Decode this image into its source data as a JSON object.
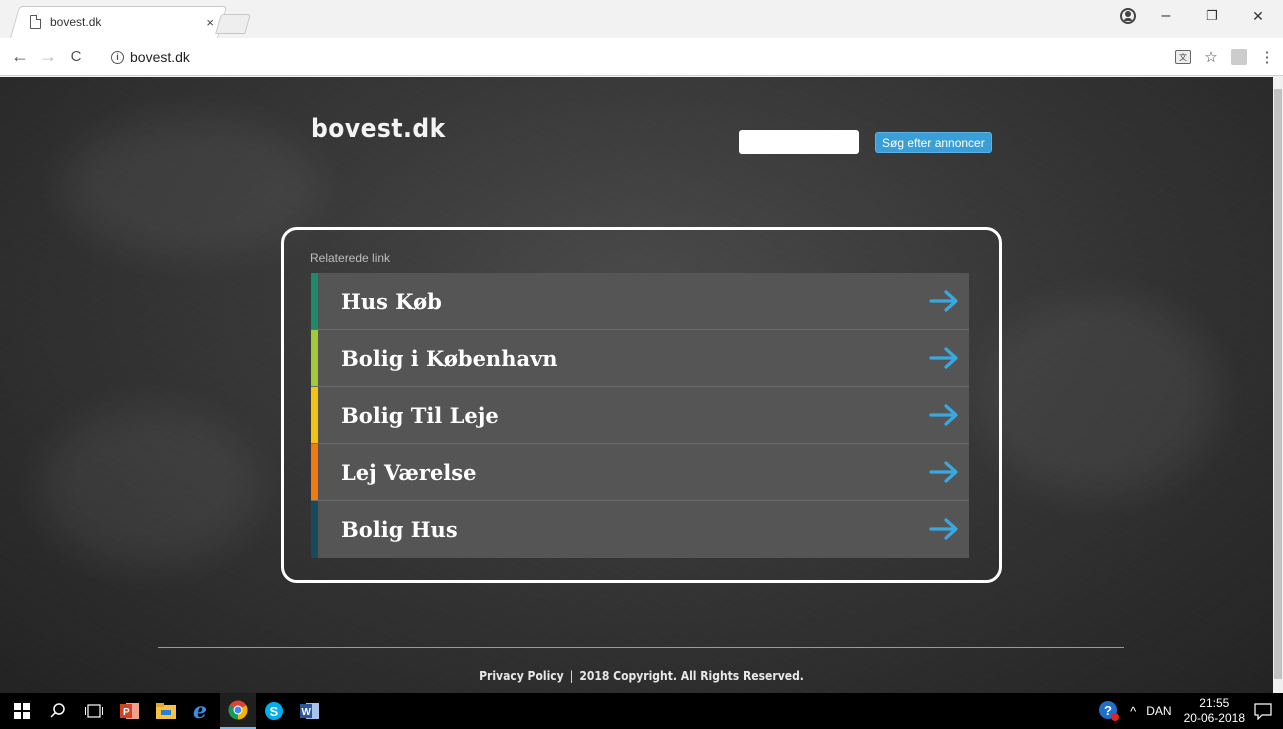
{
  "browser": {
    "tab_title": "bovest.dk",
    "tab_close": "×",
    "url": "bovest.dk",
    "info_glyph": "i",
    "back_glyph": "←",
    "forward_glyph": "→",
    "reload_glyph": "C",
    "minimize_glyph": "–",
    "restore_glyph": "❐",
    "close_glyph": "✕",
    "star_glyph": "☆",
    "menu_glyph": "⋮",
    "translate_glyph": "文"
  },
  "site": {
    "title": "bovest.dk",
    "search_placeholder": "",
    "search_button": "Søg efter annoncer",
    "panel_label": "Relaterede link",
    "links": [
      {
        "label": "Hus Køb",
        "accent": "#1d8a6c"
      },
      {
        "label": "Bolig i København",
        "accent": "#a3c93a"
      },
      {
        "label": "Bolig Til Leje",
        "accent": "#f2c40f"
      },
      {
        "label": "Lej Værelse",
        "accent": "#f07a10"
      },
      {
        "label": "Bolig Hus",
        "accent": "#164a5c"
      }
    ],
    "arrow_color": "#3aa8e0",
    "footer_privacy": "Privacy Policy",
    "footer_separator": "|",
    "footer_copyright": "2018 Copyright. All Rights Reserved."
  },
  "taskbar": {
    "apps": [
      "start",
      "search",
      "task-view",
      "powerpoint",
      "file-explorer",
      "internet-explorer",
      "chrome",
      "skype",
      "word"
    ],
    "tray_chevron": "^",
    "language": "DAN",
    "time": "21:55",
    "date": "20-06-2018"
  }
}
